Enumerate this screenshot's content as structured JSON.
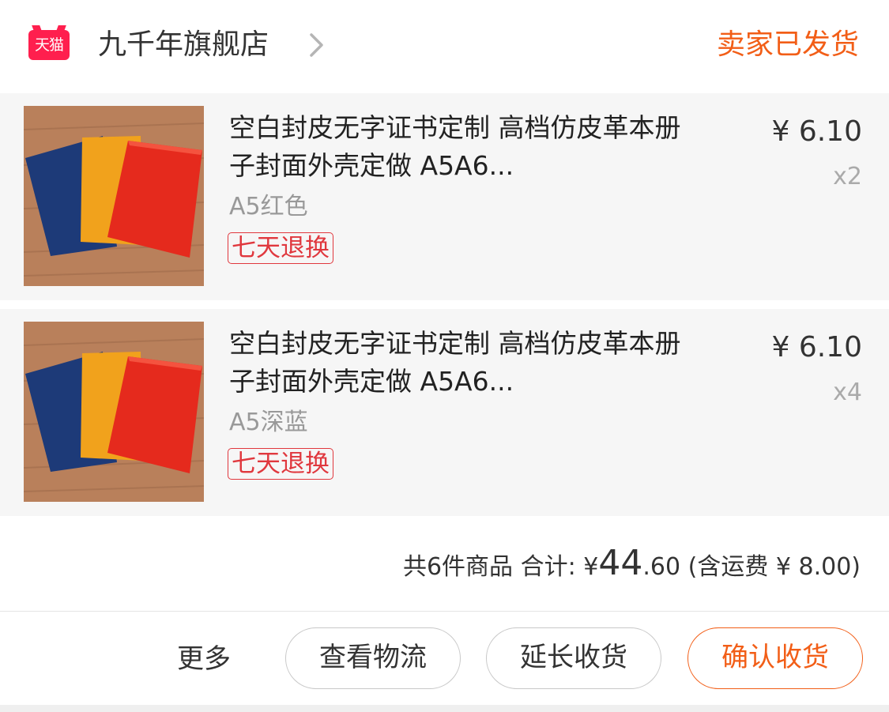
{
  "shop": {
    "logo_text": "天猫",
    "name": "九千年旗舰店",
    "status": "卖家已发货"
  },
  "items": [
    {
      "title": "空白封皮无字证书定制 高档仿皮革本册子封面外壳定做 A5A6...",
      "sku": "A5红色",
      "tag": "七天退换",
      "price": "¥ 6.10",
      "qty": "x2"
    },
    {
      "title": "空白封皮无字证书定制 高档仿皮革本册子封面外壳定做 A5A6...",
      "sku": "A5深蓝",
      "tag": "七天退换",
      "price": "¥ 6.10",
      "qty": "x4"
    }
  ],
  "summary": {
    "count_label": "共6件商品",
    "total_label": "合计:",
    "currency": "¥",
    "total_int": "44",
    "total_dec": ".60",
    "shipping": "(含运费 ¥ 8.00)"
  },
  "actions": {
    "more": "更多",
    "logistics": "查看物流",
    "extend": "延长收货",
    "confirm": "确认收货"
  },
  "colors": {
    "accent": "#f25e17",
    "tag_red": "#e0383e",
    "tmall_red": "#ff1f4e"
  }
}
